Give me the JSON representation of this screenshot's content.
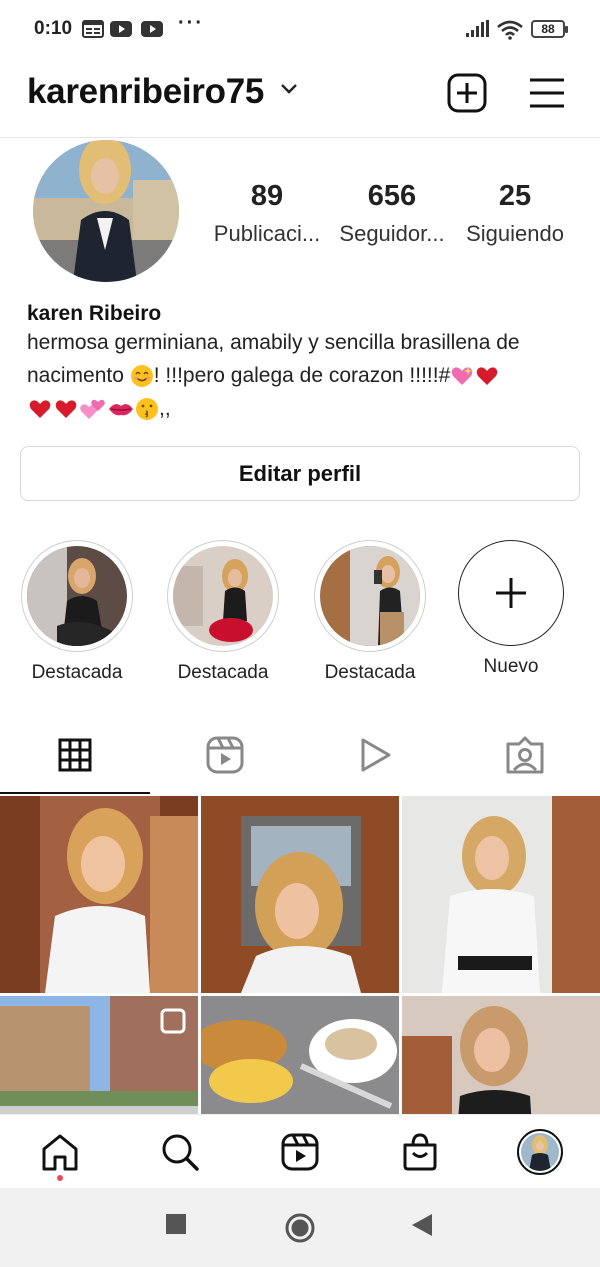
{
  "status_bar": {
    "time": "0:10",
    "battery": "88"
  },
  "header": {
    "username": "karenribeiro75",
    "icons": [
      "chevron-down-icon",
      "new-post-icon",
      "menu-icon"
    ]
  },
  "profile": {
    "stats": [
      {
        "value": "89",
        "label": "Publicaci..."
      },
      {
        "value": "656",
        "label": "Seguidor..."
      },
      {
        "value": "25",
        "label": "Siguiendo"
      }
    ],
    "name": "karen Ribeiro",
    "bio_line1": "hermosa germiniana, amabily y sencilla brasillena de",
    "bio_line2_a": "nacimento",
    "bio_line2_b": "! !!!pero galega de corazon !!!!!#",
    "bio_line3_end": ",,",
    "edit_button": "Editar perfil"
  },
  "highlights": [
    {
      "label": "Destacada"
    },
    {
      "label": "Destacada"
    },
    {
      "label": "Destacada"
    },
    {
      "label": "Nuevo"
    }
  ],
  "tabs": [
    "grid-icon",
    "reels-icon",
    "video-icon",
    "tagged-icon"
  ],
  "bottom_nav": [
    "home-icon",
    "search-icon",
    "reels-icon",
    "shop-icon",
    "profile-avatar"
  ],
  "colors": {
    "accent_dot": "#ed4956",
    "heart": "#d81b2b",
    "divider": "#e4e4e4"
  }
}
